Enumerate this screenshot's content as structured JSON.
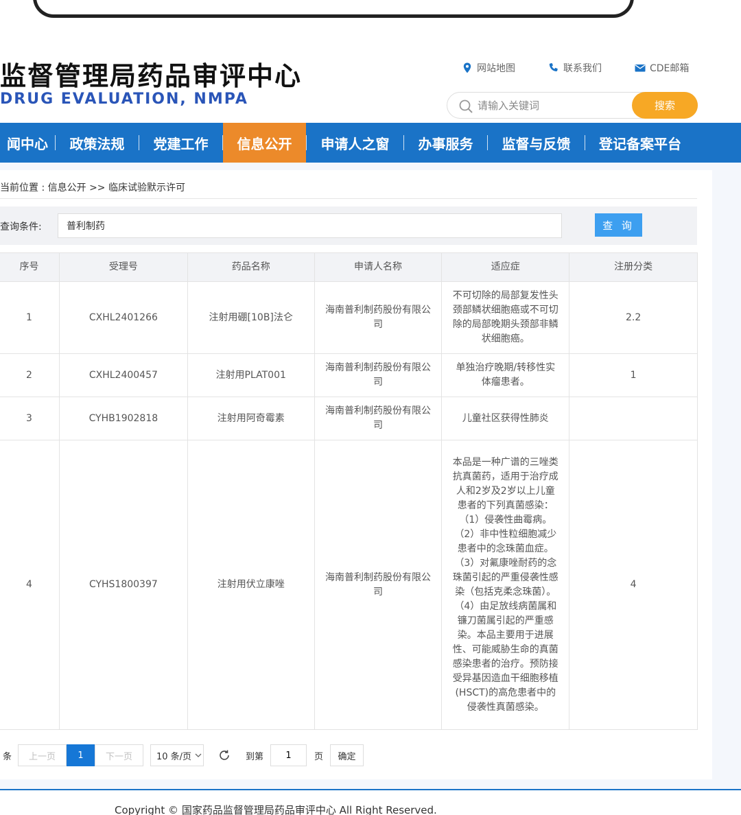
{
  "header": {
    "title": "监督管理局药品审评中心",
    "subtitle": "DRUG EVALUATION, NMPA",
    "links": [
      {
        "label": "网站地图",
        "icon": "location-pin-icon"
      },
      {
        "label": "联系我们",
        "icon": "phone-icon"
      },
      {
        "label": "CDE邮箱",
        "icon": "mail-icon"
      }
    ],
    "search": {
      "placeholder": "请输入关键词",
      "button_label": "搜索"
    }
  },
  "nav": {
    "items": [
      {
        "label": "闻中心"
      },
      {
        "label": "政策法规"
      },
      {
        "label": "党建工作"
      },
      {
        "label": "信息公开",
        "active": true
      },
      {
        "label": "申请人之窗"
      },
      {
        "label": "办事服务"
      },
      {
        "label": "监督与反馈"
      },
      {
        "label": "登记备案平台"
      }
    ]
  },
  "breadcrumb": "当前位置 : 信息公开 >> 临床试验默示许可",
  "query": {
    "label": "查询条件:",
    "value": "普利制药",
    "button_label": "查 询"
  },
  "table": {
    "columns": [
      "序号",
      "受理号",
      "药品名称",
      "申请人名称",
      "适应症",
      "注册分类"
    ],
    "rows": [
      {
        "no": "1",
        "accept_no": "CXHL2401266",
        "drug": "注射用硼[10B]法仑",
        "applicant": "海南普利制药股份有限公司",
        "indication": "不可切除的局部复发性头颈部鳞状细胞癌或不可切除的局部晚期头颈部非鳞状细胞癌。",
        "category": "2.2"
      },
      {
        "no": "2",
        "accept_no": "CXHL2400457",
        "drug": "注射用PLAT001",
        "applicant": "海南普利制药股份有限公司",
        "indication": "单独治疗晚期/转移性实体瘤患者。",
        "category": "1"
      },
      {
        "no": "3",
        "accept_no": "CYHB1902818",
        "drug": "注射用阿奇霉素",
        "applicant": "海南普利制药股份有限公司",
        "indication": "儿童社区获得性肺炎",
        "category": ""
      },
      {
        "no": "4",
        "accept_no": "CYHS1800397",
        "drug": "注射用伏立康唑",
        "applicant": "海南普利制药股份有限公司",
        "indication": "本品是一种广谱的三唑类抗真菌药，适用于治疗成人和2岁及2岁以上儿童患者的下列真菌感染：（1）侵袭性曲霉病。（2）非中性粒细胞减少患者中的念珠菌血症。（3）对氟康唑耐药的念珠菌引起的严重侵袭性感染（包括克柔念珠菌）。（4）由足放线病菌属和镰刀菌属引起的严重感染。本品主要用于进展性、可能威胁生命的真菌感染患者的治疗。预防接受异基因造血干细胞移植(HSCT)的高危患者中的侵袭性真菌感染。",
        "category": "4"
      }
    ]
  },
  "pager": {
    "total_suffix": "条",
    "prev_label": "上一页",
    "current_page": "1",
    "next_label": "下一页",
    "page_size_label": "10 条/页",
    "goto_label": "到第",
    "goto_value": "1",
    "page_unit": "页",
    "confirm_label": "确定"
  },
  "footer": {
    "copyright": "Copyright © 国家药品监督管理局药品审评中心   All Right Reserved."
  },
  "colors": {
    "nav_bg": "#1a73c7",
    "nav_active": "#ec8a2a",
    "search_button": "#f7a825",
    "query_button": "#3d9ff0",
    "subtitle": "#2a55b8"
  }
}
